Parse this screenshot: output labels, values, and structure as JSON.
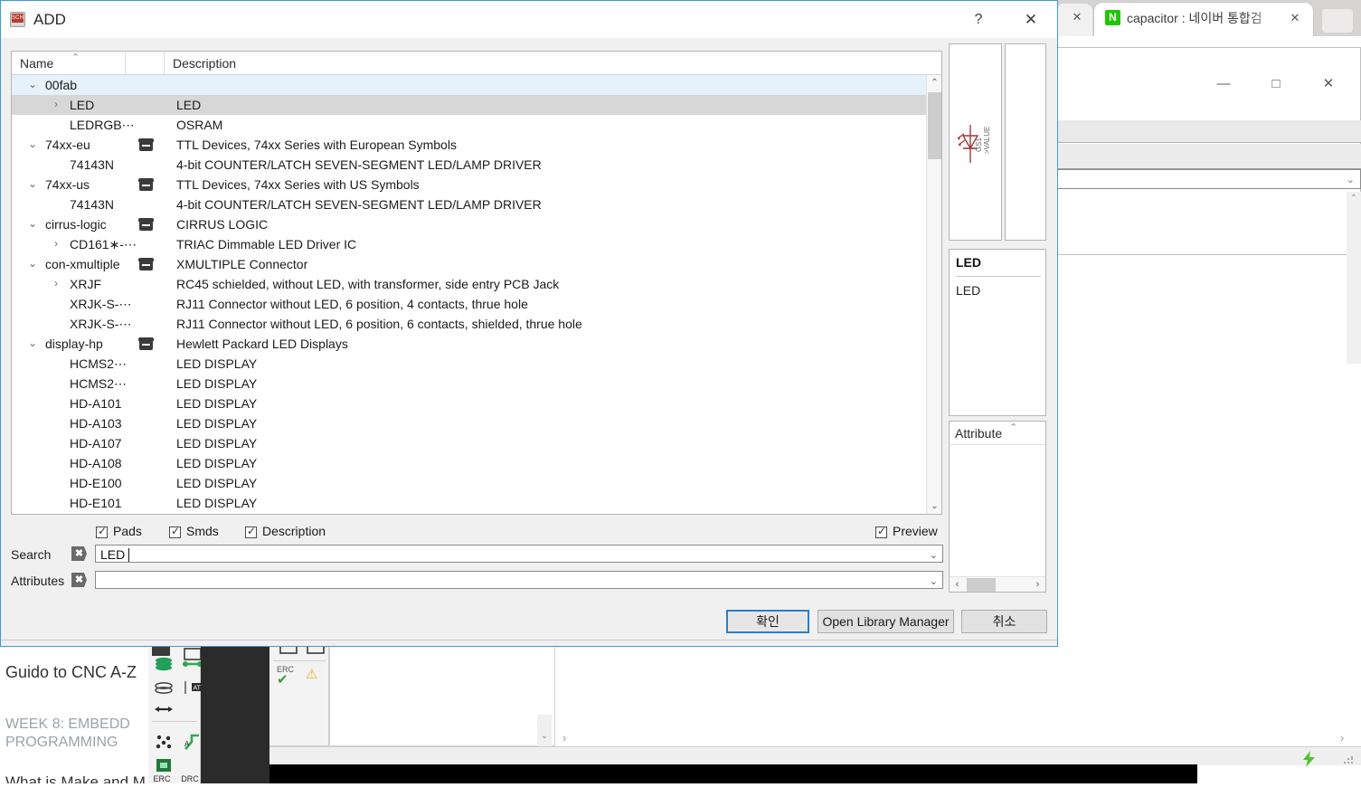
{
  "browser": {
    "tab_title": "capacitor : 네이버 통합검",
    "favicon_letter": "N",
    "close_icon": "✕",
    "prev_tab_close_icon": "✕"
  },
  "background_window": {
    "minimize_icon": "—",
    "maximize_icon": "□",
    "close_icon": "✕",
    "combo_arrow": "⌄",
    "scroll_up_icon": "⌃",
    "scroll_down_icon": "⌄",
    "right_arrow_icon": "›",
    "bolt_icon": "⚡"
  },
  "background_text": {
    "line1": "Guido to CNC A-Z",
    "line2": "WEEK 8: EMBEDD",
    "line3": "PROGRAMMING",
    "line4": "What is Make and M"
  },
  "eagle_toolbar": {
    "erc_label": "ERC",
    "drc_label": "DRC",
    "erc_ok_icon": "✔",
    "warning_icon": "⚠"
  },
  "dialog": {
    "title": "ADD",
    "icon_label": "SCH",
    "help_icon": "?",
    "close_icon": "✕",
    "columns": {
      "name": "Name",
      "description": "Description",
      "sort_indicator": "⌃"
    },
    "rows": [
      {
        "indent": 0,
        "chevron": "⌄",
        "name": "00fab",
        "lib": false,
        "desc": "",
        "state": "blue"
      },
      {
        "indent": 1,
        "chevron": "›",
        "name": "LED",
        "lib": false,
        "desc": "LED",
        "state": "gray"
      },
      {
        "indent": 1,
        "chevron": "",
        "name": "LEDRGB⋯",
        "lib": false,
        "desc": "OSRAM",
        "state": ""
      },
      {
        "indent": 0,
        "chevron": "⌄",
        "name": "74xx-eu",
        "lib": true,
        "desc": "TTL Devices, 74xx Series with European Symbols",
        "state": ""
      },
      {
        "indent": 1,
        "chevron": "",
        "name": "74143N",
        "lib": false,
        "desc": "4-bit COUNTER/LATCH SEVEN-SEGMENT LED/LAMP DRIVER",
        "state": ""
      },
      {
        "indent": 0,
        "chevron": "⌄",
        "name": "74xx-us",
        "lib": true,
        "desc": "TTL Devices, 74xx Series with US Symbols",
        "state": ""
      },
      {
        "indent": 1,
        "chevron": "",
        "name": "74143N",
        "lib": false,
        "desc": "4-bit COUNTER/LATCH SEVEN-SEGMENT LED/LAMP DRIVER",
        "state": ""
      },
      {
        "indent": 0,
        "chevron": "⌄",
        "name": "cirrus-logic",
        "lib": true,
        "desc": "CIRRUS LOGIC",
        "state": ""
      },
      {
        "indent": 1,
        "chevron": "›",
        "name": "CD161∗-⋯",
        "lib": false,
        "desc": "TRIAC Dimmable LED Driver IC",
        "state": ""
      },
      {
        "indent": 0,
        "chevron": "⌄",
        "name": "con-xmultiple",
        "lib": true,
        "desc": "XMULTIPLE Connector",
        "state": ""
      },
      {
        "indent": 1,
        "chevron": "›",
        "name": "XRJF",
        "lib": false,
        "desc": "RC45 schielded, without LED, with transformer, side entry PCB Jack",
        "state": ""
      },
      {
        "indent": 1,
        "chevron": "",
        "name": "XRJK-S-⋯",
        "lib": false,
        "desc": "RJ11 Connector without LED, 6 position, 4 contacts, thrue hole",
        "state": ""
      },
      {
        "indent": 1,
        "chevron": "",
        "name": "XRJK-S-⋯",
        "lib": false,
        "desc": "RJ11 Connector without LED, 6 position, 6 contacts, shielded, thrue hole",
        "state": ""
      },
      {
        "indent": 0,
        "chevron": "⌄",
        "name": "display-hp",
        "lib": true,
        "desc": "Hewlett Packard LED Displays",
        "state": ""
      },
      {
        "indent": 1,
        "chevron": "",
        "name": "HCMS2⋯",
        "lib": false,
        "desc": "LED DISPLAY",
        "state": ""
      },
      {
        "indent": 1,
        "chevron": "",
        "name": "HCMS2⋯",
        "lib": false,
        "desc": "LED DISPLAY",
        "state": ""
      },
      {
        "indent": 1,
        "chevron": "",
        "name": "HD-A101",
        "lib": false,
        "desc": "LED DISPLAY",
        "state": ""
      },
      {
        "indent": 1,
        "chevron": "",
        "name": "HD-A103",
        "lib": false,
        "desc": "LED DISPLAY",
        "state": ""
      },
      {
        "indent": 1,
        "chevron": "",
        "name": "HD-A107",
        "lib": false,
        "desc": "LED DISPLAY",
        "state": ""
      },
      {
        "indent": 1,
        "chevron": "",
        "name": "HD-A108",
        "lib": false,
        "desc": "LED DISPLAY",
        "state": ""
      },
      {
        "indent": 1,
        "chevron": "",
        "name": "HD-E100",
        "lib": false,
        "desc": "LED DISPLAY",
        "state": ""
      },
      {
        "indent": 1,
        "chevron": "",
        "name": "HD-E101",
        "lib": false,
        "desc": "LED DISPLAY",
        "state": ""
      }
    ],
    "scroll": {
      "up_icon": "⌃",
      "down_icon": "⌄",
      "left_icon": "‹",
      "right_icon": "›"
    },
    "preview": {
      "symbol_name": "GS1",
      "symbol_value": ">VALUE",
      "symbol_color": "#a03a3a"
    },
    "description_panel": {
      "title": "LED",
      "body": "LED"
    },
    "attribute_panel": {
      "header": "Attribute",
      "sort_indicator": "⌃"
    },
    "checkboxes": [
      {
        "label": "Pads",
        "checked": true
      },
      {
        "label": "Smds",
        "checked": true
      },
      {
        "label": "Description",
        "checked": true
      }
    ],
    "preview_checkbox": {
      "label": "Preview",
      "checked": true
    },
    "search": {
      "label": "Search",
      "value": "LED",
      "clear_icon": "✖",
      "combo_arrow": "⌄"
    },
    "attributes": {
      "label": "Attributes",
      "value": "",
      "clear_icon": "✖",
      "combo_arrow": "⌄"
    },
    "buttons": {
      "ok": "확인",
      "library_manager": "Open Library Manager",
      "cancel": "취소"
    },
    "colors": {
      "accent": "#2a7fc9",
      "selection_blue": "#e5f1fb",
      "selection_gray": "#d7d7d7"
    }
  }
}
